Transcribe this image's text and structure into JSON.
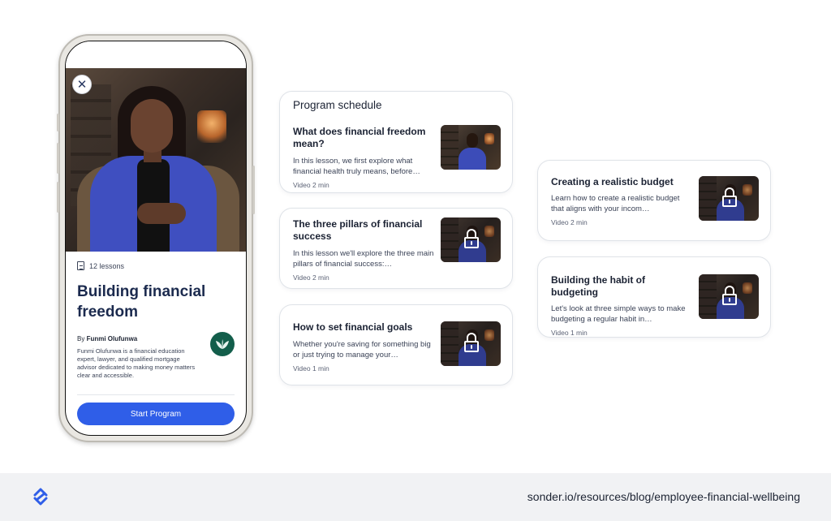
{
  "phone": {
    "close_icon": "close-icon",
    "lessons_icon": "document-icon",
    "lessons_count": "12 lessons",
    "program_title": "Building financial freedom",
    "author_prefix": "By",
    "author_name": "Funmi Olufunwa",
    "author_bio": "Funmi Olufunwa is a financial education expert, lawyer, and qualified mortgage advisor dedicated to making money matters clear and accessible.",
    "start_button": "Start Program",
    "accent_color": "#2f5ee8",
    "avatar_color": "#135e4b"
  },
  "schedule": {
    "heading": "Program schedule",
    "lessons": [
      {
        "title": "What does financial freedom mean?",
        "description": "In this lesson, we first explore what financial health truly means, before…",
        "meta": "Video 2 min",
        "locked": false
      },
      {
        "title": "The three pillars of financial success",
        "description": "In this lesson we'll explore the three main pillars of financial success:…",
        "meta": "Video 2 min",
        "locked": true
      },
      {
        "title": "How to set financial goals",
        "description": "Whether you're saving for something big or just trying to manage your…",
        "meta": "Video 1 min",
        "locked": true
      }
    ]
  },
  "more_lessons": [
    {
      "title": "Creating a realistic budget",
      "description": "Learn how to create a realistic budget that aligns with your incom…",
      "meta": "Video 2 min",
      "locked": true
    },
    {
      "title": "Building the habit of budgeting",
      "description": "Let's look at three simple ways to make budgeting a regular habit in…",
      "meta": "Video 1 min",
      "locked": true
    }
  ],
  "footer": {
    "logo_icon": "sonder-logo-icon",
    "url": "sonder.io/resources/blog/employee-financial-wellbeing"
  }
}
